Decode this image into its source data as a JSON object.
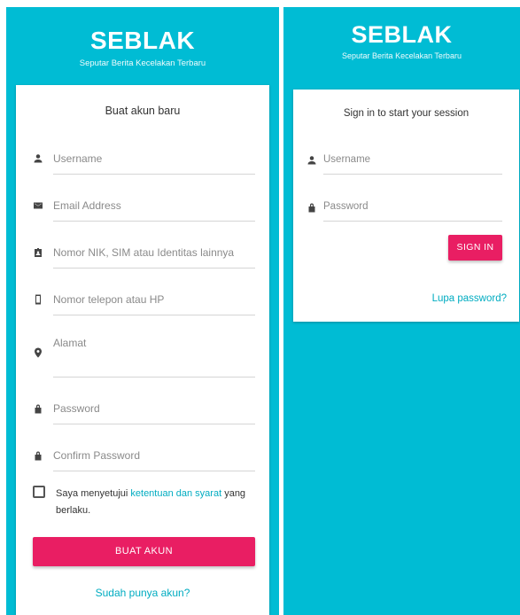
{
  "register_screen": {
    "brand": {
      "title": "SEBLAK",
      "subtitle": "Seputar Berita Kecelakan Terbaru"
    },
    "heading": "Buat akun baru",
    "fields": [
      {
        "icon": "person-icon",
        "placeholder": "Username"
      },
      {
        "icon": "email-icon",
        "placeholder": "Email Address"
      },
      {
        "icon": "id-badge-icon",
        "placeholder": "Nomor NIK, SIM atau Identitas lainnya"
      },
      {
        "icon": "phone-icon",
        "placeholder": "Nomor telepon atau HP"
      },
      {
        "icon": "location-icon",
        "placeholder": "Alamat"
      },
      {
        "icon": "lock-icon",
        "placeholder": "Password"
      },
      {
        "icon": "lock-icon",
        "placeholder": "Confirm Password"
      }
    ],
    "terms": {
      "prefix": "Saya menyetujui ",
      "link": "ketentuan dan syarat",
      "suffix": " yang berlaku.",
      "checked": false
    },
    "submit_label": "BUAT AKUN",
    "login_link": "Sudah punya akun?"
  },
  "login_screen": {
    "brand": {
      "title": "SEBLAK",
      "subtitle": "Seputar Berita Kecelakan Terbaru"
    },
    "heading": "Sign in to start your session",
    "fields": [
      {
        "icon": "person-icon",
        "placeholder": "Username"
      },
      {
        "icon": "lock-icon",
        "placeholder": "Password"
      }
    ],
    "submit_label": "SIGN IN",
    "forgot_link": "Lupa password?"
  },
  "colors": {
    "brand_background": "#00bcd4",
    "primary_button": "#e91e63",
    "link": "#00acc1"
  }
}
